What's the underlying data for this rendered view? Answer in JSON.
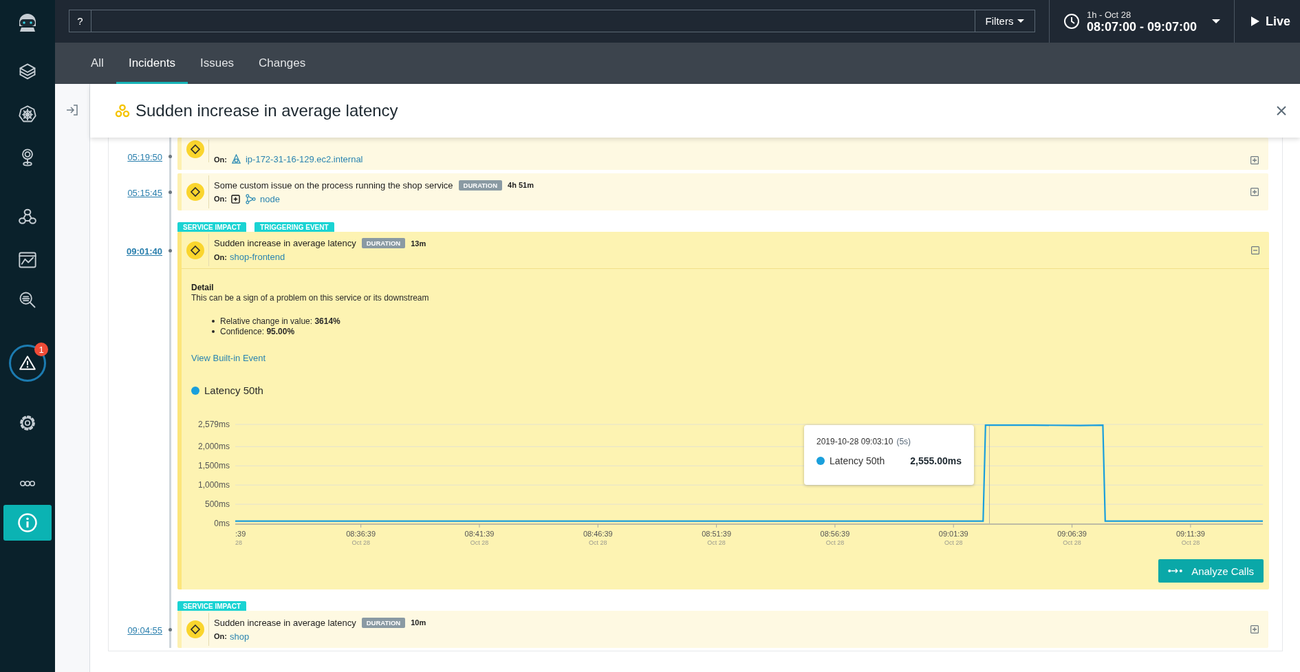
{
  "sidebar": {
    "items": [
      {
        "selected": false
      },
      {
        "selected": false
      },
      {
        "selected": false
      },
      {
        "selected": false
      },
      {
        "selected": false
      },
      {
        "selected": false
      },
      {
        "selected": false,
        "badge": "1"
      },
      {
        "selected": false
      },
      {
        "selected": false
      },
      {
        "selected": true
      }
    ]
  },
  "search": {
    "help": "?",
    "filters": "Filters"
  },
  "time_range": {
    "range": "1h - Oct 28",
    "value": "08:07:00 - 09:07:00"
  },
  "live": {
    "label": "Live"
  },
  "tabs": [
    {
      "label": "All",
      "selected": false
    },
    {
      "label": "Incidents",
      "selected": true
    },
    {
      "label": "Issues",
      "selected": false
    },
    {
      "label": "Changes",
      "selected": false
    }
  ],
  "incident": {
    "title": "Sudden increase in average latency"
  },
  "events": [
    {
      "kind": "host",
      "time": "05:19:50",
      "selected": false,
      "expanded": false,
      "on_label": "On:",
      "target": "ip-172-31-16-129.ec2.internal"
    },
    {
      "kind": "node",
      "time": "05:15:45",
      "selected": false,
      "expanded": false,
      "title": "Some custom issue on the process running the shop service",
      "duration_label": "DURATION",
      "duration": "4h 51m",
      "on_label": "On:",
      "target": "node"
    },
    {
      "kind": "service",
      "time": "09:01:40",
      "selected": true,
      "expanded": true,
      "tags": [
        "SERVICE IMPACT",
        "TRIGGERING EVENT"
      ],
      "title": "Sudden increase in average latency",
      "duration_label": "DURATION",
      "duration": "13m",
      "on_label": "On:",
      "target": "shop-frontend",
      "detail": {
        "heading": "Detail",
        "text": "This can be a sign of a problem on this service or its downstream",
        "bullets": [
          "Relative change in value: **3614%**",
          "Confidence: **95.00%**"
        ],
        "link": "View Built-in Event",
        "chart_data": {
          "type": "line",
          "x": [
            30681,
            30780,
            30900,
            31020,
            31140,
            31260,
            31380,
            31500,
            31620,
            31740,
            31860,
            31980,
            32100,
            32220,
            32340,
            32460,
            32574,
            32580,
            32700,
            32820,
            32877,
            32883,
            33000,
            33120,
            33282
          ],
          "series": [
            {
              "name": "Latency 50th",
              "color": "#1a9fdc",
              "values": [
                60,
                60,
                60,
                60,
                60,
                60,
                60,
                60,
                60,
                60,
                60,
                60,
                60,
                60,
                60,
                60,
                60,
                2560,
                2560,
                2550,
                2560,
                60,
                60,
                60,
                60
              ]
            }
          ],
          "xlim": [
            30681,
            33282
          ],
          "ylim": [
            0,
            2579
          ],
          "yticks": [
            {
              "value": 0,
              "label": "0ms"
            },
            {
              "value": 500,
              "label": "500ms"
            },
            {
              "value": 1000,
              "label": "1,000ms"
            },
            {
              "value": 1500,
              "label": "1,500ms"
            },
            {
              "value": 2000,
              "label": "2,000ms"
            },
            {
              "value": 2579,
              "label": "2,579ms"
            }
          ],
          "grid": true,
          "ref_lines": [
            {
              "axis": "x",
              "value": 32590
            }
          ],
          "xticks": [
            {
              "value": 30999,
              "label": "08:36:39"
            },
            {
              "value": 31299,
              "label": "08:41:39"
            },
            {
              "value": 31599,
              "label": "08:46:39"
            },
            {
              "value": 31899,
              "label": "08:51:39"
            },
            {
              "value": 32199,
              "label": "08:56:39"
            },
            {
              "value": 32499,
              "label": "09:01:39"
            },
            {
              "value": 32799,
              "label": "09:06:39"
            },
            {
              "value": 33099,
              "label": "09:11:39"
            }
          ]
        },
        "x_cut_label": ":39",
        "x_cut_date": "28",
        "xtick_dates": [
          "Oct 28",
          "Oct 28",
          "Oct 28",
          "Oct 28",
          "Oct 28",
          "Oct 28",
          "Oct 28",
          "Oct 28"
        ],
        "tooltip": {
          "time": "2019-10-28 09:03:10",
          "interval": "(5s)",
          "series": "Latency 50th",
          "value": "2,555.00ms"
        },
        "button": "Analyze Calls"
      }
    },
    {
      "kind": "service",
      "time": "09:04:55",
      "selected": false,
      "expanded": false,
      "tags": [
        "SERVICE IMPACT"
      ],
      "title": "Sudden increase in average latency",
      "duration_label": "DURATION",
      "duration": "10m",
      "on_label": "On:",
      "target": "shop"
    }
  ]
}
